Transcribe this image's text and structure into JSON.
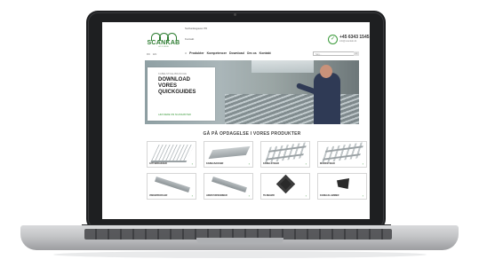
{
  "site": {
    "top_small": "Sorbanksgaven 55",
    "contact_label": "Kontakt",
    "logo": {
      "name": "SCANKAB",
      "tagline": "A/S SCANIA"
    },
    "phone": "+45 6343 1545",
    "email": "info@scankab.dk",
    "languages": [
      "DK",
      "EN"
    ],
    "nav": [
      "Produkter",
      "Kompetencer",
      "Download",
      "Om os",
      "Kontakt"
    ],
    "search": {
      "placeholder": "Søg...",
      "button_icon": "search-icon"
    }
  },
  "hero": {
    "kicker": "KABELSTIGE-BRANCHE",
    "title_lines": [
      "DOWNLOAD",
      "VORES",
      "QUICKGUIDES"
    ],
    "cta": "LÆS MERE OM SCANKAB HER"
  },
  "products": {
    "heading": "GÅ PÅ OPDAGELSE I VORES PRODUKTER",
    "tiles": [
      {
        "label": "GITTERBAKKER",
        "icon": "wire-tray-icon"
      },
      {
        "label": "KABELBAKKER",
        "icon": "cable-tray-icon"
      },
      {
        "label": "KABELSTIGER",
        "icon": "cable-ladder-icon"
      },
      {
        "label": "MARKSTIGER",
        "icon": "ladder-icon"
      },
      {
        "label": "VINKEPROFILER",
        "icon": "profile-rail-icon"
      },
      {
        "label": "ARMATURSKINNER",
        "icon": "luminaire-rail-icon"
      },
      {
        "label": "TILBEHØR",
        "icon": "accessory-icon"
      },
      {
        "label": "KABELKLAMMER",
        "icon": "cable-clamp-icon"
      }
    ],
    "arrow": "›"
  },
  "colors": {
    "brand_green": "#2e7d32",
    "accent_green": "#3a9a3a",
    "laptop_frame": "#1e1f21"
  }
}
